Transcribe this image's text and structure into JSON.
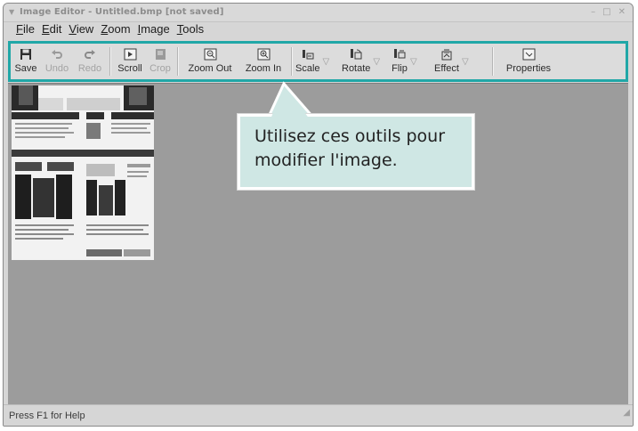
{
  "window": {
    "title": "Image Editor - Untitled.bmp [not saved]",
    "controls": [
      "–",
      "□",
      "✕"
    ]
  },
  "menubar": {
    "items": [
      {
        "key": "F",
        "rest": "ile"
      },
      {
        "key": "E",
        "rest": "dit"
      },
      {
        "key": "V",
        "rest": "iew"
      },
      {
        "key": "Z",
        "rest": "oom"
      },
      {
        "key": "I",
        "rest": "mage"
      },
      {
        "key": "T",
        "rest": "ools"
      }
    ]
  },
  "toolbar": {
    "save": "Save",
    "undo": "Undo",
    "redo": "Redo",
    "scroll": "Scroll",
    "crop": "Crop",
    "zoom_out": "Zoom Out",
    "zoom_in": "Zoom In",
    "scale": "Scale",
    "rotate": "Rotate",
    "flip": "Flip",
    "effect": "Effect",
    "properties": "Properties"
  },
  "callout": {
    "line1": "Utilisez ces outils pour",
    "line2": "modifier l'image."
  },
  "status": {
    "text": "Press F1 for Help"
  },
  "colors": {
    "toolbar_highlight": "#21a7a7",
    "callout_fill": "#cfe7e4",
    "canvas_background": "#9c9c9c"
  }
}
